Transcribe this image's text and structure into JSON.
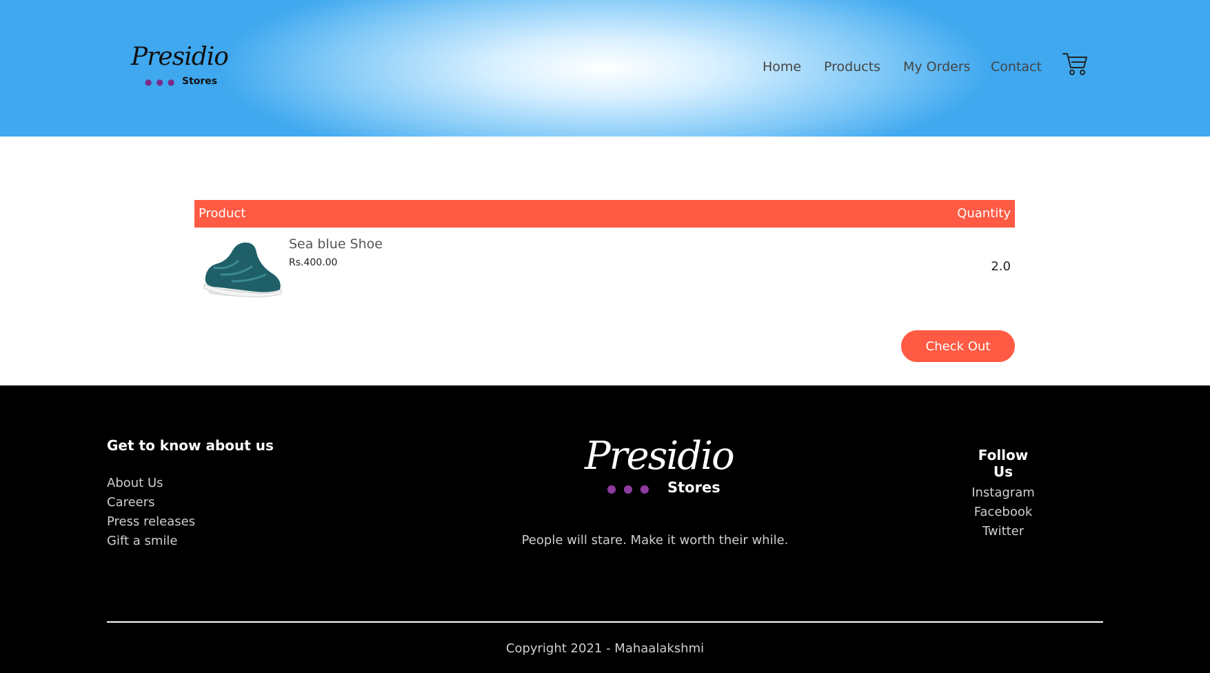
{
  "header": {
    "logo": {
      "script": "Presidio",
      "sub": "Stores"
    },
    "nav": {
      "home": "Home",
      "products": "Products",
      "my_orders": "My Orders",
      "contact": "Contact"
    },
    "cart_icon": "shopping-cart-icon"
  },
  "cart": {
    "columns": {
      "product": "Product",
      "quantity": "Quantity"
    },
    "items": [
      {
        "name": "Sea blue Shoe",
        "price": "Rs.400.00",
        "quantity": "2.0",
        "image_icon": "shoe-image"
      }
    ],
    "checkout_label": "Check Out"
  },
  "footer": {
    "about_title": "Get to know about us",
    "about_links": [
      "About Us",
      "Careers",
      "Press releases",
      "Gift a smile"
    ],
    "logo": {
      "script": "Presidio",
      "sub": "Stores"
    },
    "tagline": "People will stare. Make it worth their while.",
    "follow_title": "Follow Us",
    "follow_links": [
      "Instagram",
      "Facebook",
      "Twitter"
    ],
    "copyright": "Copyright 2021 - Mahaalakshmi"
  },
  "colors": {
    "accent": "#ff5a43",
    "header_blue": "#3fa8ef",
    "footer_bg": "#000000",
    "logo_dots": "#7a2c8c"
  }
}
